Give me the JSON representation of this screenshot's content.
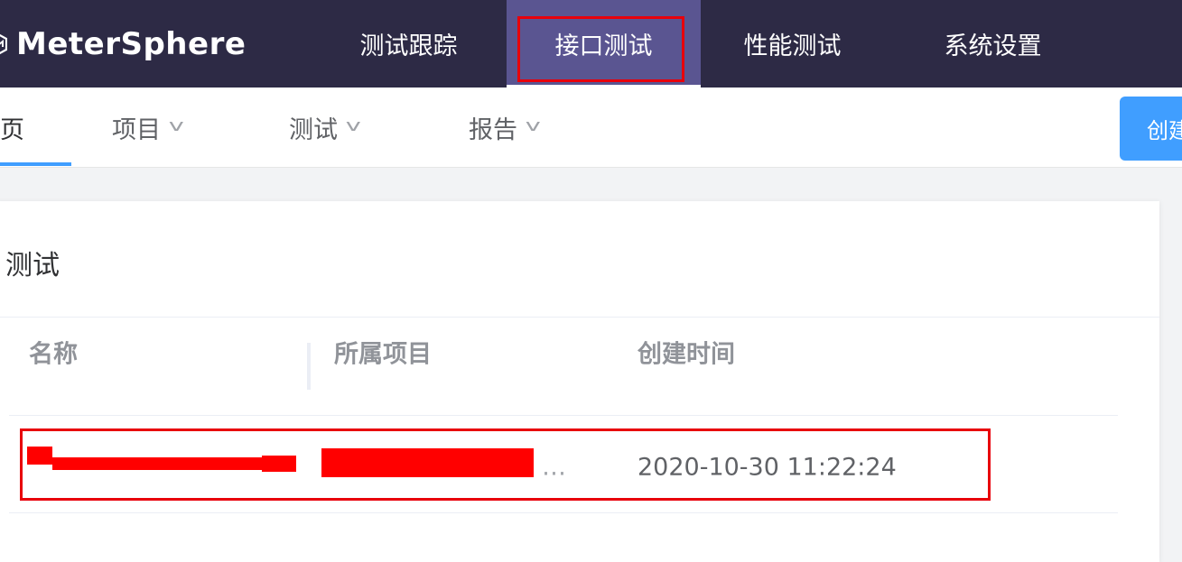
{
  "header": {
    "logo_text": "MeterSphere",
    "tabs": [
      {
        "label": "测试跟踪",
        "active": false
      },
      {
        "label": "接口测试",
        "active": true
      },
      {
        "label": "性能测试",
        "active": false
      },
      {
        "label": "系统设置",
        "active": false
      }
    ]
  },
  "subnav": {
    "home_label": "页",
    "menus": [
      {
        "label": "项目"
      },
      {
        "label": "测试"
      },
      {
        "label": "报告"
      }
    ],
    "create_button_label": "创建"
  },
  "card": {
    "title": "测试",
    "table": {
      "columns": [
        "名称",
        "所属项目",
        "创建时间"
      ],
      "rows": [
        {
          "name": "",
          "project_suffix": "…",
          "created_at": "2020-10-30 11:22:24"
        }
      ]
    }
  },
  "icons": {
    "logo": "metersphere-logo-icon",
    "dropdown": "chevron-down-icon"
  },
  "colors": {
    "topbar_bg": "#2d2a45",
    "active_tab_bg": "#5a5591",
    "accent": "#409eff",
    "annotation_red": "#e8000b"
  }
}
